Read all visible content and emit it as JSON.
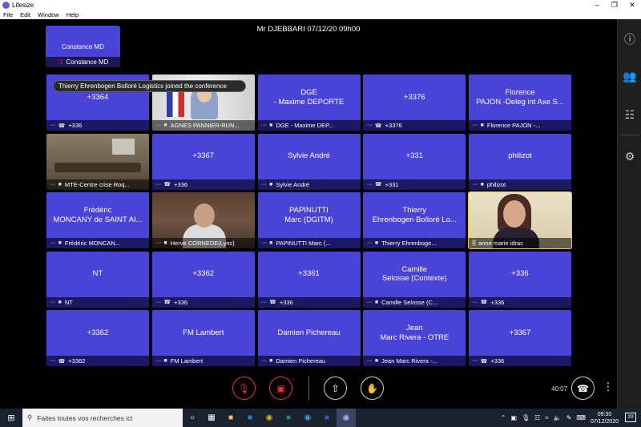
{
  "window": {
    "title": "Lifesize"
  },
  "menu": [
    "File",
    "Edit",
    "Window",
    "Help"
  ],
  "conference": {
    "title": "Mr DJEBBARI 07/12/20 09h00"
  },
  "self_view": {
    "name": "Constance MD",
    "footer_name": "Constance MD"
  },
  "toast": "Thierry Ehrenbogen Bolloré Logistics joined the conference",
  "tiles": [
    {
      "name": "+3364",
      "footer": "+336"
    },
    {
      "name": "",
      "footer": "AGNES PANNIER-RUN..."
    },
    {
      "name": "DGE\n- Maxime DEPORTE",
      "footer": "DGE - Maxime DEP..."
    },
    {
      "name": "+3376",
      "footer": "+3376"
    },
    {
      "name": "Florence\nPAJON -Deleg int Axe S...",
      "footer": "Florence PAJON -..."
    },
    {
      "name": "",
      "footer": "MTE-Centre crise Roq..."
    },
    {
      "name": "+3367",
      "footer": "+336"
    },
    {
      "name": "Sylvie André",
      "footer": "Sylvie André"
    },
    {
      "name": "+331",
      "footer": "+331"
    },
    {
      "name": "philizot",
      "footer": "philizot"
    },
    {
      "name": "Frédéric\nMONCANY de SAINT AI...",
      "footer": "Frédéric MONCAN..."
    },
    {
      "name": "",
      "footer": "Herve CORNEDE(Lync)"
    },
    {
      "name": "PAPINUTTI\nMarc (DGITM)",
      "footer": "PAPINUTTI Marc (..."
    },
    {
      "name": "Thierry\nEhrenbogen Bolloré Lo...",
      "footer": "Thierry Ehrenboge..."
    },
    {
      "name": "",
      "footer": "anne marie idrac"
    },
    {
      "name": "NT",
      "footer": "NT"
    },
    {
      "name": "+3362",
      "footer": "+336"
    },
    {
      "name": "+3361",
      "footer": "+336"
    },
    {
      "name": "Camille\nSelosse (Contexte)",
      "footer": "Camille Selosse (C..."
    },
    {
      "name": "+336",
      "footer": "+336"
    },
    {
      "name": "+3362",
      "footer": "+3362"
    },
    {
      "name": "FM Lambert",
      "footer": "FM Lambert"
    },
    {
      "name": "Damien Pichereau",
      "footer": "Damien Pichereau"
    },
    {
      "name": "Jean\nMarc Rivera - OTRE",
      "footer": "Jean Marc Rivera -..."
    },
    {
      "name": "+3367",
      "footer": "+336"
    }
  ],
  "controls": {
    "timer": "40:07"
  },
  "taskbar": {
    "search_placeholder": "Faites toutes vos recherches ici",
    "time": "09:30",
    "date": "07/12/2020",
    "notifications": "20"
  }
}
